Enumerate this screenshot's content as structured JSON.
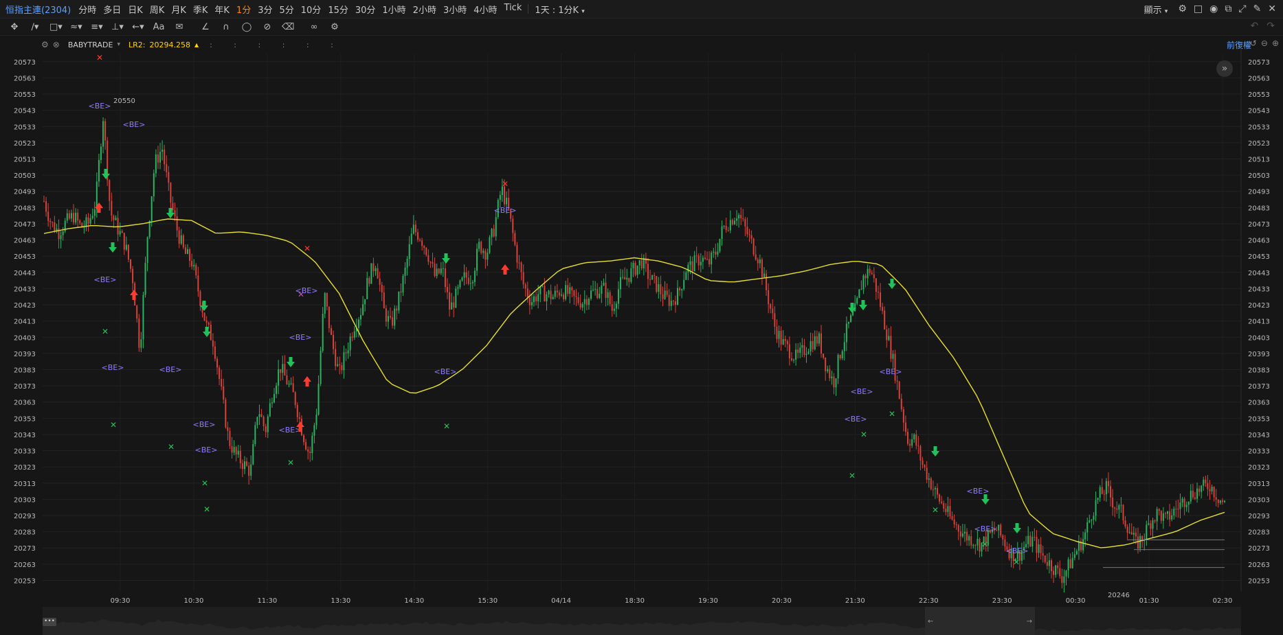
{
  "topbar": {
    "symbol": "恒指主連(2304)",
    "timeframes": [
      "分時",
      "多日",
      "日K",
      "周K",
      "月K",
      "季K",
      "年K",
      "1分",
      "3分",
      "5分",
      "10分",
      "15分",
      "30分",
      "1小時",
      "2小時",
      "3小時",
      "4小時",
      "Tick"
    ],
    "active_timeframe": "1分",
    "range_selector": "1天 : 1分K",
    "display_menu": "顯示"
  },
  "toolbar": {
    "icons": [
      "crosshair-icon",
      "trendline-icon",
      "rectangle-icon",
      "pattern-icon",
      "fibonacci-icon",
      "measure-icon",
      "text-icon",
      "comment-icon",
      "ruler-icon",
      "magnet-icon",
      "lock-icon",
      "hide-icon",
      "delete-icon",
      "link-icon",
      "settings-icon"
    ]
  },
  "legend": {
    "indicator_name": "BABYTRADE",
    "lr_label": "LR2:",
    "lr_value": "20294.258",
    "dots": ":  :  :  :  :  :"
  },
  "adjust_label": "前復權",
  "chart_data": {
    "type": "candlestick",
    "y_ticks": [
      20573,
      20563,
      20553,
      20543,
      20533,
      20523,
      20513,
      20503,
      20493,
      20483,
      20473,
      20463,
      20453,
      20443,
      20433,
      20423,
      20413,
      20403,
      20393,
      20383,
      20373,
      20363,
      20353,
      20343,
      20333,
      20323,
      20313,
      20303,
      20293,
      20283,
      20273,
      20263,
      20253
    ],
    "ylim": [
      20246,
      20578
    ],
    "x_ticks": [
      "09:30",
      "10:30",
      "11:30",
      "13:30",
      "14:30",
      "15:30",
      "04/14",
      "18:30",
      "19:30",
      "20:30",
      "21:30",
      "22:30",
      "23:30",
      "00:30",
      "01:30",
      "02:30"
    ],
    "high_label": "20550",
    "low_label": "20246",
    "close_path": [
      20487,
      20473,
      20468,
      20474,
      20478,
      20471,
      20473,
      20486,
      20540,
      20480,
      20470,
      20460,
      20440,
      20395,
      20465,
      20510,
      20520,
      20490,
      20470,
      20455,
      20450,
      20430,
      20410,
      20400,
      20370,
      20340,
      20330,
      20325,
      20320,
      20360,
      20345,
      20370,
      20385,
      20375,
      20365,
      20345,
      20330,
      20360,
      20430,
      20400,
      20380,
      20395,
      20410,
      20420,
      20440,
      20450,
      20420,
      20410,
      20425,
      20445,
      20470,
      20465,
      20455,
      20440,
      20445,
      20420,
      20430,
      20440,
      20440,
      20460,
      20455,
      20470,
      20495,
      20480,
      20455,
      20435,
      20425,
      20430,
      20430,
      20428,
      20432,
      20430,
      20426,
      20425,
      20430,
      20432,
      20433,
      20420,
      20435,
      20440,
      20445,
      20450,
      20440,
      20435,
      20428,
      20425,
      20430,
      20445,
      20448,
      20452,
      20448,
      20455,
      20470,
      20475,
      20480,
      20470,
      20460,
      20450,
      20430,
      20410,
      20400,
      20395,
      20390,
      20395,
      20400,
      20402,
      20385,
      20375,
      20395,
      20410,
      20420,
      20440,
      20445,
      20430,
      20410,
      20390,
      20365,
      20340,
      20340,
      20325,
      20315,
      20305,
      20298,
      20290,
      20285,
      20280,
      20278,
      20275,
      20280,
      20285,
      20278,
      20270,
      20268,
      20275,
      20278,
      20270,
      20265,
      20260,
      20255,
      20263,
      20272,
      20280,
      20295,
      20305,
      20310,
      20300,
      20295,
      20285,
      20275,
      20280,
      20290,
      20295,
      20290,
      20295,
      20300,
      20305,
      20308,
      20310,
      20312,
      20305,
      20300
    ],
    "ma_path": [
      20467,
      20470,
      20472,
      20471,
      20473,
      20476,
      20475,
      20467,
      20468,
      20466,
      20462,
      20450,
      20430,
      20400,
      20375,
      20368,
      20373,
      20383,
      20398,
      20418,
      20432,
      20445,
      20449,
      20450,
      20452,
      20450,
      20446,
      20438,
      20437,
      20439,
      20441,
      20444,
      20448,
      20450,
      20448,
      20433,
      20410,
      20390,
      20365,
      20330,
      20295,
      20282,
      20277,
      20273,
      20275,
      20279,
      20283,
      20290,
      20295
    ]
  },
  "signals": {
    "be_label": "<BE>",
    "buy_color": "#ff3b30",
    "sell_color": "#1fc35a",
    "ma_color": "#e8e02a",
    "up_candle_color": "#28b463",
    "down_candle_color": "#d9423a"
  },
  "scrollbar": {
    "dots_label": "•••",
    "left_arrow": "←",
    "right_arrow": "→"
  }
}
